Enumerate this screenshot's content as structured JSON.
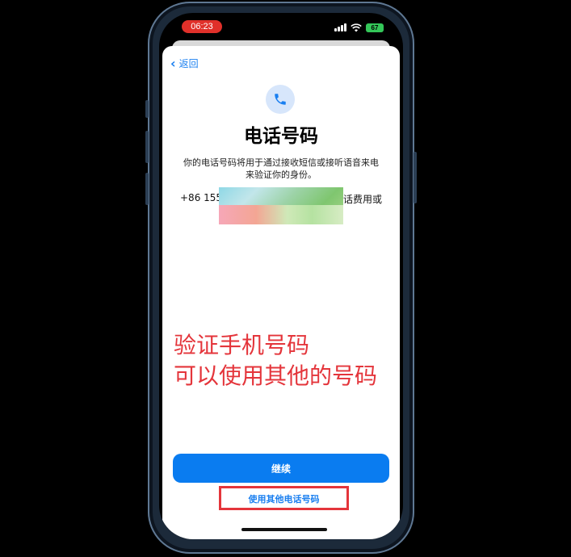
{
  "status_bar": {
    "time": "06:23",
    "battery": "67"
  },
  "nav": {
    "back_label": "返回"
  },
  "content": {
    "title": "电话号码",
    "description": "你的电话号码将用于通过接收短信或接听语音来电来验证你的身份。",
    "phone_prefix": "+86 155",
    "phone_suffix": "话费用或"
  },
  "overlay": {
    "line1": "验证手机号码",
    "line2": "可以使用其他的号码"
  },
  "actions": {
    "continue_label": "继续",
    "other_number_label": "使用其他电话号码"
  },
  "colors": {
    "accent": "#0a7cf0",
    "annotation": "#e4353b",
    "time_pill": "#e0302a",
    "battery": "#34c759"
  },
  "icons": [
    "phone-icon",
    "chevron-left-icon",
    "wifi-icon",
    "cellular-signal-icon",
    "battery-icon"
  ]
}
